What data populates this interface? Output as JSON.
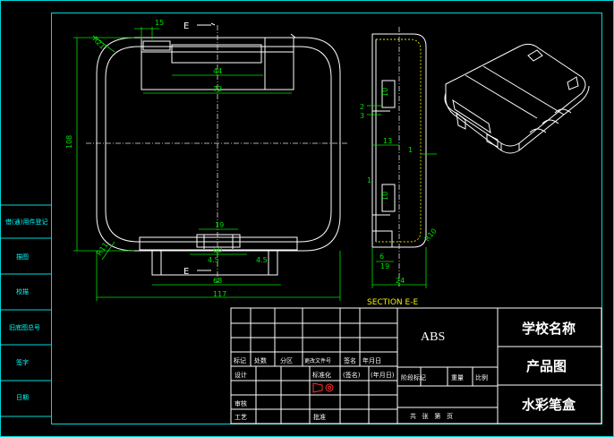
{
  "drawing": {
    "section_marker_top": "E",
    "section_marker_bottom": "E",
    "section_label": "SECTION E-E",
    "front_dims": {
      "d_15": "15",
      "d_44": "44",
      "d_72": "72",
      "d_108": "108",
      "d_19": "19",
      "d_60": "60",
      "d_4_5_left": "4.5",
      "d_4_5_right": "4.5",
      "d_68": "68",
      "d_117": "117",
      "r_top_left": "R21",
      "r_bottom_left": "R11"
    },
    "section_dims": {
      "d_10_top": "10",
      "d_2": "2",
      "d_3": "3",
      "d_13": "13",
      "d_1_left": "1",
      "d_1_right": "1",
      "d_10_bottom": "10",
      "d_6": "6",
      "d_19": "19",
      "d_24": "24",
      "r_10": "R10"
    }
  },
  "side_labels": [
    "借(通)用件登记",
    "描图",
    "校描",
    "旧底图总号",
    "签字",
    "日期"
  ],
  "title_block": {
    "material": "ABS",
    "school": "学校名称",
    "drawing_type": "产品图",
    "part_name": "水彩笔盒",
    "row_labels": [
      "标记",
      "处数",
      "分区",
      "更改文件号",
      "签名",
      "年月日"
    ],
    "design": "设计",
    "standardize": "标准化",
    "sign": "(签名)",
    "date": "(年月日)",
    "stage_labels": [
      "阶段标记",
      "重量",
      "比例"
    ],
    "review": "审核",
    "process": "工艺",
    "approve": "批准",
    "sheets": "共   张   第   页"
  }
}
